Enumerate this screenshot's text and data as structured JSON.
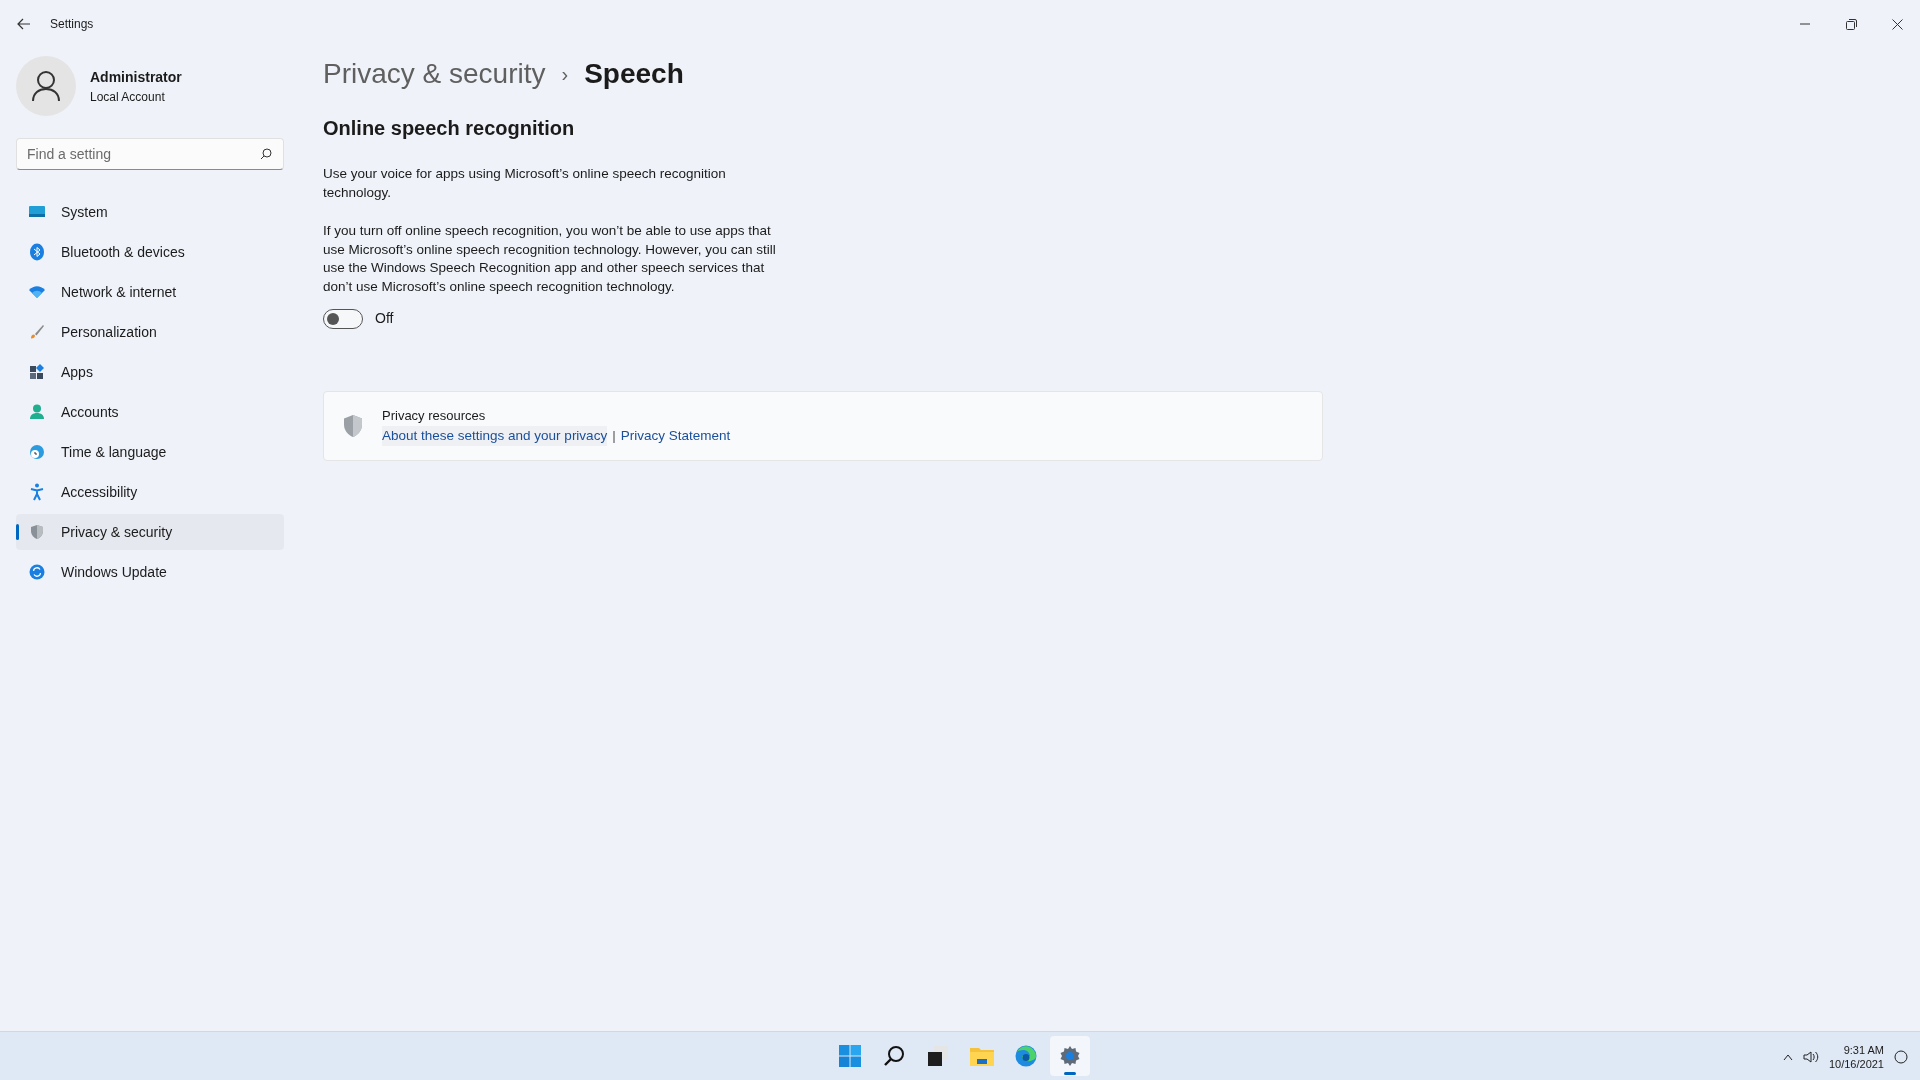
{
  "window": {
    "title": "Settings"
  },
  "account": {
    "name": "Administrator",
    "type": "Local Account"
  },
  "search": {
    "placeholder": "Find a setting"
  },
  "sidebar": {
    "items": [
      {
        "label": "System",
        "selected": false
      },
      {
        "label": "Bluetooth & devices",
        "selected": false
      },
      {
        "label": "Network & internet",
        "selected": false
      },
      {
        "label": "Personalization",
        "selected": false
      },
      {
        "label": "Apps",
        "selected": false
      },
      {
        "label": "Accounts",
        "selected": false
      },
      {
        "label": "Time & language",
        "selected": false
      },
      {
        "label": "Accessibility",
        "selected": false
      },
      {
        "label": "Privacy & security",
        "selected": true
      },
      {
        "label": "Windows Update",
        "selected": false
      }
    ]
  },
  "breadcrumb": {
    "parent": "Privacy & security",
    "separator": "›",
    "current": "Speech"
  },
  "section": {
    "title": "Online speech recognition",
    "paragraphs": [
      "Use your voice for apps using Microsoft’s online speech recognition technology.",
      "If you turn off online speech recognition, you won’t be able to use apps that use Microsoft’s online speech recognition technology. However, you can still use the Windows Speech Recognition app and other speech services that don’t use Microsoft’s online speech recognition technology."
    ],
    "toggle": {
      "on": false,
      "label": "Off"
    }
  },
  "resources": {
    "title": "Privacy resources",
    "links": [
      "About these settings and your privacy",
      "Privacy Statement"
    ],
    "separator": "|"
  },
  "taskbar": {
    "apps": [
      {
        "selected": false
      },
      {
        "selected": false
      },
      {
        "selected": false
      },
      {
        "selected": false
      },
      {
        "selected": false
      },
      {
        "selected": true
      }
    ],
    "time": "9:31 AM",
    "date": "10/16/2021"
  }
}
